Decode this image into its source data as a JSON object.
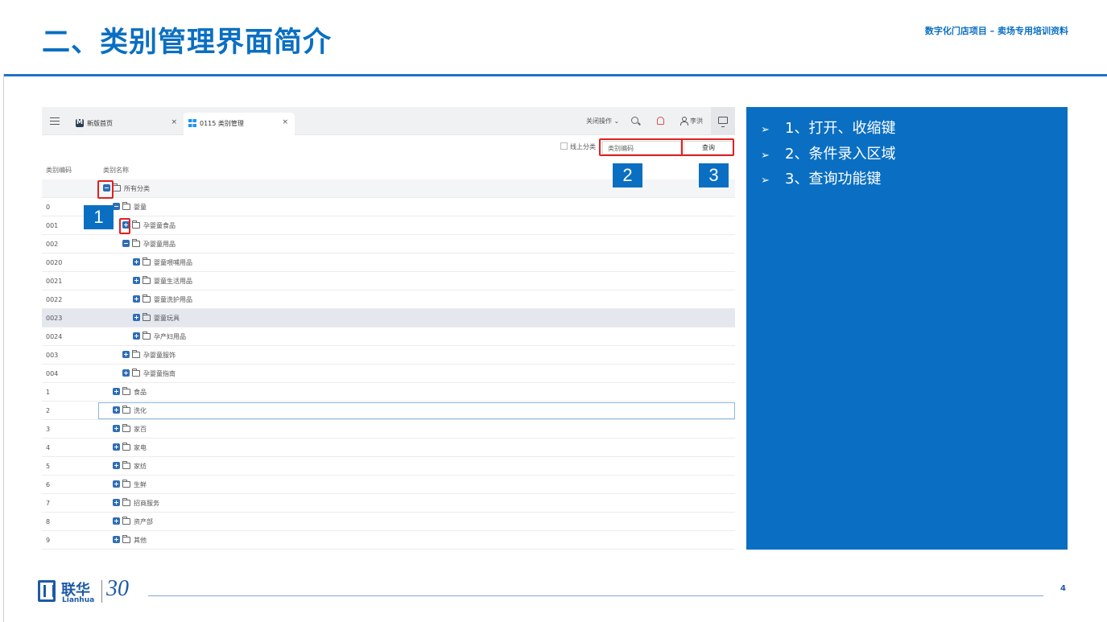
{
  "slide": {
    "title": "二、类别管理界面简介",
    "subtitle": "数字化门店项目 – 卖场专用培训资料",
    "page_number": "4"
  },
  "app": {
    "tabs": [
      {
        "label": "新版首页",
        "icon": "mail-icon",
        "close": "×"
      },
      {
        "label": "0115 类别管理",
        "icon": "grid-icon",
        "close": "×"
      }
    ],
    "top_actions": {
      "close_ops": "关闭操作 ⌄",
      "user_name": "李洪"
    },
    "filter": {
      "online_label": "线上分类",
      "code_placeholder": "类别编码",
      "query_label": "查询"
    },
    "columns": {
      "code": "类别编码",
      "name": "类别名称"
    },
    "rows": [
      {
        "code": "",
        "name": "所有分类",
        "toggle": "minus"
      },
      {
        "code": "0",
        "name": "婴童",
        "toggle": "minus"
      },
      {
        "code": "001",
        "name": "孕婴童食品",
        "toggle": "plus"
      },
      {
        "code": "002",
        "name": "孕婴童用品",
        "toggle": "minus"
      },
      {
        "code": "0020",
        "name": "婴童喂哺用品",
        "toggle": "plus"
      },
      {
        "code": "0021",
        "name": "婴童生活用品",
        "toggle": "plus"
      },
      {
        "code": "0022",
        "name": "婴童洗护用品",
        "toggle": "plus"
      },
      {
        "code": "0023",
        "name": "婴童玩具",
        "toggle": "plus"
      },
      {
        "code": "0024",
        "name": "孕产妇用品",
        "toggle": "plus"
      },
      {
        "code": "003",
        "name": "孕婴童服饰",
        "toggle": "plus"
      },
      {
        "code": "004",
        "name": "孕婴童指南",
        "toggle": "plus"
      },
      {
        "code": "1",
        "name": "食品",
        "toggle": "plus"
      },
      {
        "code": "2",
        "name": "洗化",
        "toggle": "plus"
      },
      {
        "code": "3",
        "name": "家百",
        "toggle": "plus"
      },
      {
        "code": "4",
        "name": "家电",
        "toggle": "plus"
      },
      {
        "code": "5",
        "name": "家纺",
        "toggle": "plus"
      },
      {
        "code": "6",
        "name": "生鲜",
        "toggle": "plus"
      },
      {
        "code": "7",
        "name": "招商服务",
        "toggle": "plus"
      },
      {
        "code": "8",
        "name": "资产部",
        "toggle": "plus"
      },
      {
        "code": "9",
        "name": "其他",
        "toggle": "plus"
      }
    ]
  },
  "callouts": [
    "1",
    "2",
    "3"
  ],
  "notes": [
    {
      "arrow": "➢",
      "text": "1、打开、收缩键"
    },
    {
      "arrow": "➢",
      "text": "2、条件录入区域"
    },
    {
      "arrow": "➢",
      "text": "3、查询功能键"
    }
  ],
  "logo": {
    "cn": "联华",
    "en": "Lianhua",
    "anniversary": "30"
  },
  "colors": {
    "brand_blue": "#0a6fc2",
    "highlight_red": "#e02020",
    "tree_toggle": "#2f6db5"
  }
}
